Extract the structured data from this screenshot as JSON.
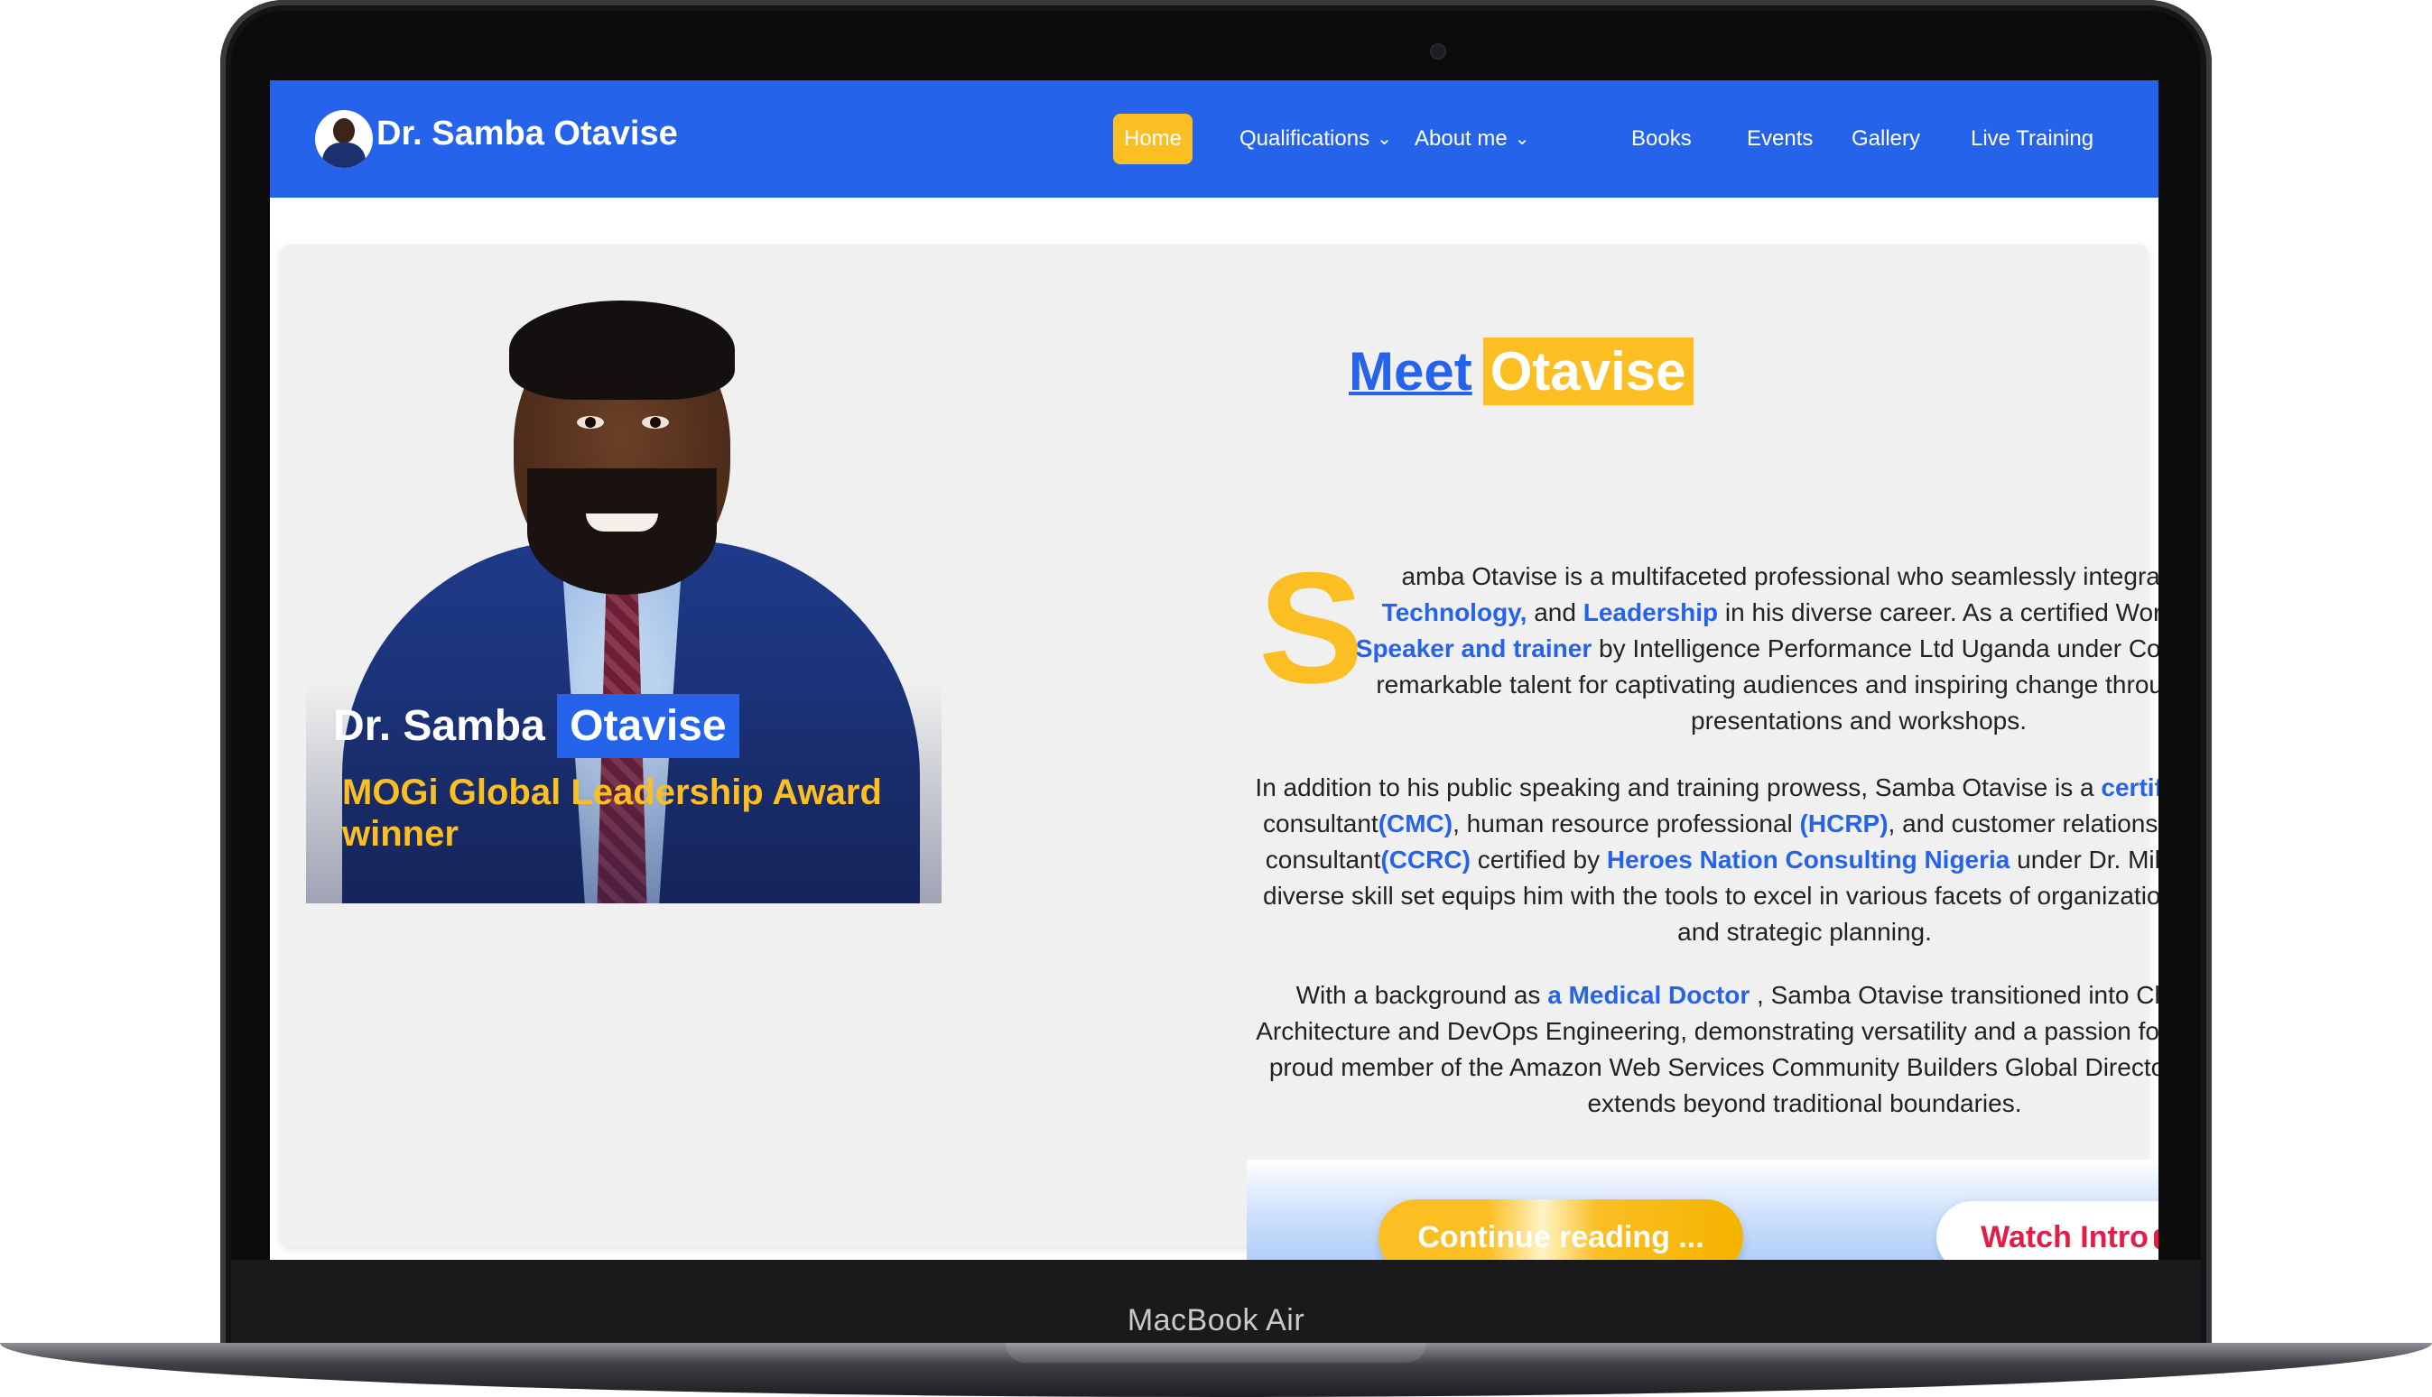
{
  "device": {
    "label": "MacBook Air"
  },
  "navbar": {
    "brand": "Dr. Samba Otavise",
    "items": [
      {
        "label": "Home",
        "active": true
      },
      {
        "label": "Qualifications",
        "dropdown": true
      },
      {
        "label": "About me",
        "dropdown": true
      },
      {
        "label": "Books"
      },
      {
        "label": "Events"
      },
      {
        "label": "Gallery"
      },
      {
        "label": "Live Training"
      }
    ]
  },
  "portrait": {
    "name_first": "Dr. Samba",
    "name_last": "Otavise",
    "award": "MOGi Global Leadership Award winner"
  },
  "heading": {
    "meet": "Meet",
    "name": "Otavise"
  },
  "about": {
    "dropcap": "S",
    "p1": {
      "t1": "amba Otavise is a multifaceted professional who seamlessly integrates ",
      "b1": "Medicine, Technology,",
      "t2": " and ",
      "b2": "Leadership",
      "t3": " in his diverse career. As a certified World-Class ",
      "b3": "Public Speaker and trainer",
      "t4": " by Intelligence Performance Ltd Uganda under Coach Phil, he has a remarkable talent for captivating audiences and inspiring change through his engaging presentations and workshops."
    },
    "p2": {
      "t1": "In addition to his public speaking and training prowess, Samba Otavise is a ",
      "b1": "certified",
      "t2": " management consultant",
      "b2": "(CMC)",
      "t3": ", human resource professional ",
      "b3": "(HCRP)",
      "t4": ", and customer relationship management consultant",
      "b4": "(CCRC)",
      "t5": " certified by ",
      "b5": "Heroes Nation Consulting Nigeria",
      "t6": " under Dr. Mike Oladipo . This diverse skill set equips him with the tools to excel in various facets of organizational development and strategic planning."
    },
    "p3": {
      "t1": "With a background as ",
      "b1": "a Medical Doctor",
      "t2": " , Samba Otavise transitioned into Cloud Solutions Architecture and DevOps Engineering, demonstrating versatility and a passion for innovation. As a proud member of the Amazon Web Services Community Builders Global Directory, his expertise extends beyond traditional boundaries."
    }
  },
  "actions": {
    "continue": "Continue reading ...",
    "watch": "Watch Intro"
  },
  "colors": {
    "primary": "#2563eb",
    "accent": "#fbbf24",
    "youtube": "#e11d48"
  }
}
